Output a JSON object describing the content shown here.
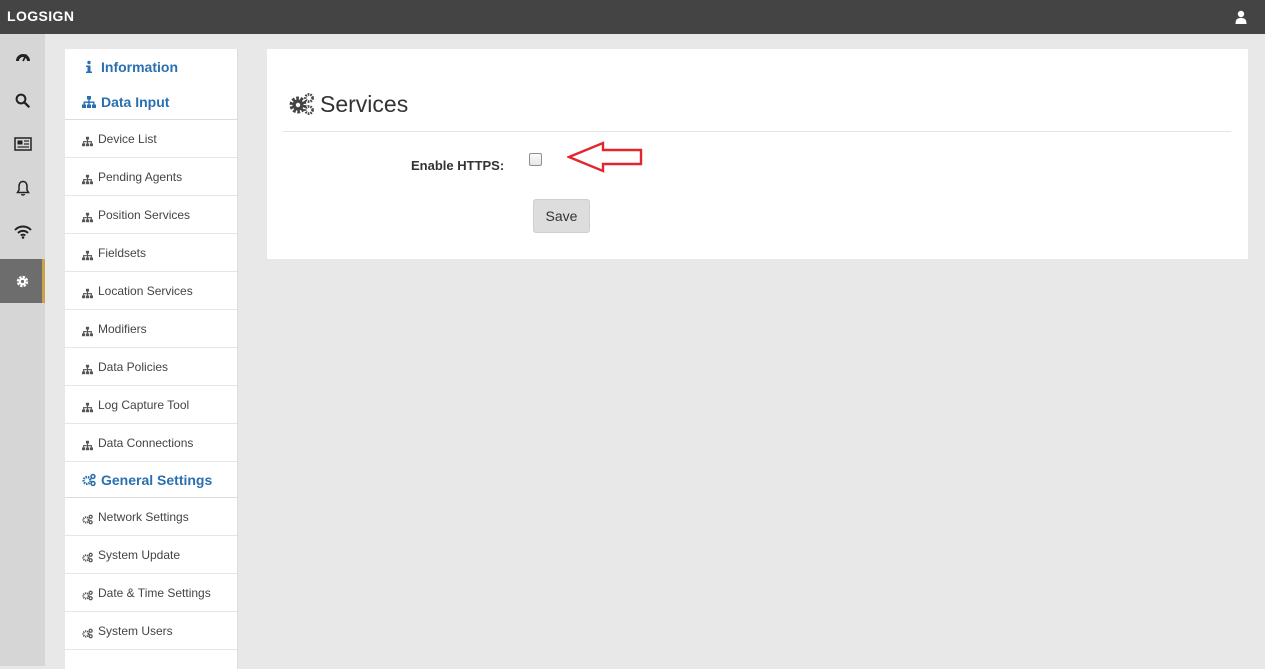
{
  "header": {
    "brand": "LOGSIGN",
    "user_icon": "user-icon"
  },
  "rail": {
    "items": [
      {
        "icon": "dashboard-icon",
        "active": false
      },
      {
        "icon": "search-icon",
        "active": false
      },
      {
        "icon": "news-icon",
        "active": false
      },
      {
        "icon": "bell-icon",
        "active": false
      },
      {
        "icon": "wifi-icon",
        "active": false
      },
      {
        "icon": "gear-icon",
        "active": true
      }
    ]
  },
  "menu": {
    "sections": [
      {
        "label": "Information",
        "icon": "info-icon"
      },
      {
        "label": "Data Input",
        "icon": "sitemap-icon",
        "items": [
          "Device List",
          "Pending Agents",
          "Position Services",
          "Fieldsets",
          "Location Services",
          "Modifiers",
          "Data Policies",
          "Log Capture Tool",
          "Data Connections"
        ]
      },
      {
        "label": "General Settings",
        "icon": "gears-icon",
        "items": [
          "Network Settings",
          "System Update",
          "Date & Time Settings",
          "System Users"
        ]
      }
    ]
  },
  "panel": {
    "title": "Services",
    "title_icon": "gears-icon",
    "enable_https_label": "Enable HTTPS:",
    "enable_https_checked": false,
    "save_label": "Save",
    "annotation": "red-arrow-icon",
    "colors": {
      "accent": "#2a6fb0",
      "topbar": "#444444",
      "arrow": "#e3262d",
      "active_rail": "#6d6d6d"
    }
  }
}
